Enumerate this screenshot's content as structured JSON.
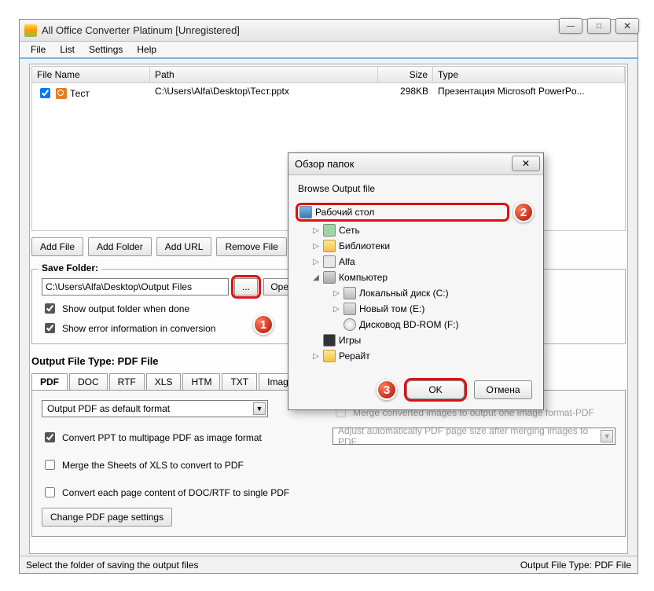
{
  "window": {
    "title": "All Office Converter Platinum [Unregistered]"
  },
  "winbuttons": {
    "min": "—",
    "max": "□",
    "close": "✕"
  },
  "menu": [
    "File",
    "List",
    "Settings",
    "Help"
  ],
  "grid": {
    "headers": [
      "File Name",
      "Path",
      "Size",
      "Type"
    ],
    "rows": [
      {
        "checked": true,
        "name": "Тест",
        "path": "C:\\Users\\Alfa\\Desktop\\Тест.pptx",
        "size": "298KB",
        "type": "Презентация Microsoft PowerPo..."
      }
    ]
  },
  "buttons": {
    "add_file": "Add File",
    "add_folder": "Add Folder",
    "add_url": "Add URL",
    "remove_file": "Remove File"
  },
  "save_folder": {
    "legend": "Save Folder:",
    "path": "C:\\Users\\Alfa\\Desktop\\Output Files",
    "browse": "...",
    "open": "Open",
    "show_output": "Show output folder when done",
    "show_error": "Show error information in conversion"
  },
  "output_type_label": "Output File Type:  PDF File",
  "tabs": [
    "PDF",
    "DOC",
    "RTF",
    "XLS",
    "HTM",
    "TXT",
    "Image"
  ],
  "pdf_panel": {
    "combo": "Output PDF as default format",
    "opt_ppt": "Convert PPT to multipage PDF as image format",
    "opt_xls": "Merge the Sheets of XLS to convert to PDF",
    "opt_doc": "Convert each page content of DOC/RTF to single PDF",
    "btn_settings": "Change PDF page settings",
    "right_merge": "Merge converted images to output one image format-PDF",
    "right_adjust": "Adjust automatically PDF page size after merging images to PDF"
  },
  "status": {
    "left": "Select the folder of saving the output files",
    "right": "Output File Type:  PDF File"
  },
  "dialog": {
    "title": "Обзор папок",
    "subtitle": "Browse Output file",
    "tree": {
      "desktop": "Рабочий стол",
      "network": "Сеть",
      "libraries": "Библиотеки",
      "user": "Alfa",
      "computer": "Компьютер",
      "drive_c": "Локальный диск (C:)",
      "drive_new": "Новый том (E:)",
      "drive_bd": "Дисковод BD-ROM (F:)",
      "games": "Игры",
      "rewrite": "Рерайт"
    },
    "ok": "OK",
    "cancel": "Отмена"
  },
  "badges": {
    "n1": "1",
    "n2": "2",
    "n3": "3"
  }
}
